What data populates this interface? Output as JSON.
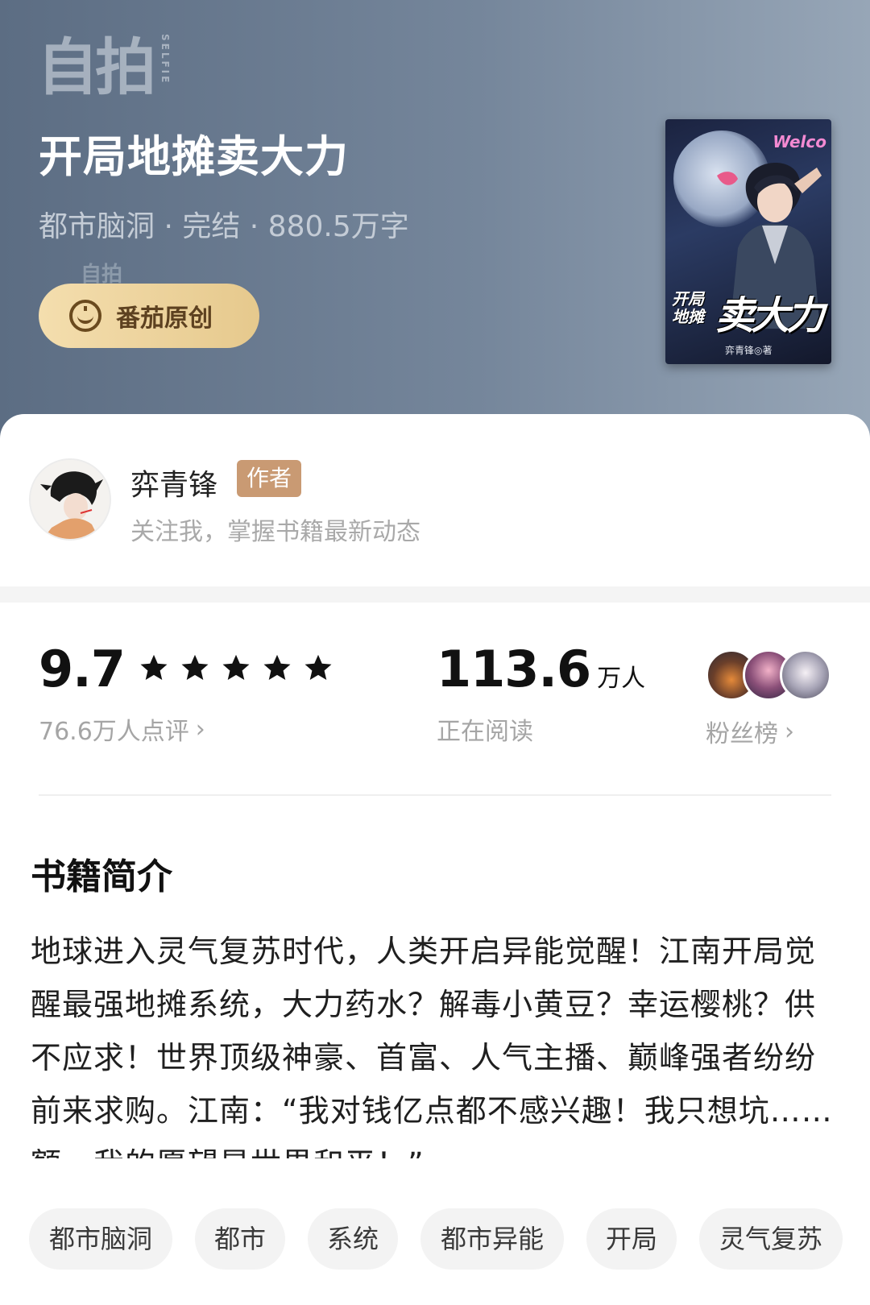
{
  "header": {
    "logo_main": "自拍",
    "logo_sub": "SELFIE",
    "title": "开局地摊卖大力",
    "meta": "都市脑洞 · 完结 · 880.5万字",
    "watermark": "自拍",
    "badge_label": "番茄原创",
    "badge_icon": "tomato-icon"
  },
  "cover": {
    "sign_text": "Welco",
    "title_small": "开局\n地摊",
    "title_big": "卖大力",
    "author_line": "弈青锋◎著"
  },
  "author": {
    "name": "弈青锋",
    "tag": "作者",
    "follow_text": "关注我，掌握书籍最新动态"
  },
  "stats": {
    "rating": "9.7",
    "stars": 5,
    "reviews": "76.6万人点评",
    "readers_count": "113.6",
    "readers_unit": "万人",
    "readers_label": "正在阅读",
    "fans_label": "粉丝榜",
    "star_color": "#111111"
  },
  "intro": {
    "heading": "书籍简介",
    "text": "地球进入灵气复苏时代，人类开启异能觉醒！江南开局觉醒最强地摊系统，大力药水？解毒小黄豆？幸运樱桃？供不应求！世界顶级神豪、首富、人气主播、巅峰强者纷纷前来求购。江南：“我对钱亿点都不感兴趣！我只想坑……额，我的愿望是世界和平！”"
  },
  "tags": [
    "都市脑洞",
    "都市",
    "系统",
    "都市异能",
    "开局",
    "灵气复苏"
  ],
  "colors": {
    "header_gradient_start": "#5c6d83",
    "header_gradient_end": "#97a6b7",
    "badge_gold": "#e6c98d",
    "author_tag_bg": "#c99a73"
  }
}
